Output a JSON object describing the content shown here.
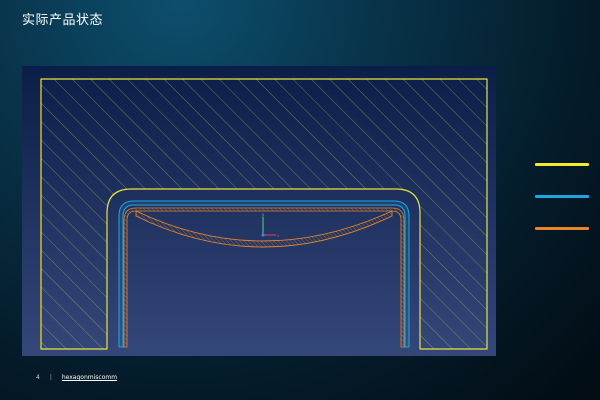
{
  "slide": {
    "title": "实际产品状态",
    "page_number": "4",
    "separator": "|",
    "brand": "hexagonmiscomm"
  },
  "colors": {
    "background_top": "#0d4f6e",
    "viewport_top": "#0b1e48",
    "viewport_bottom": "#344779",
    "outer_die": "#e8e23a",
    "blue_part": "#1fa6e0",
    "orange_part": "#e8852a"
  },
  "legend": [
    {
      "color": "#f2e933"
    },
    {
      "color": "#1fa6e0"
    },
    {
      "color": "#e8852a"
    }
  ],
  "triad": {
    "y_label": "y",
    "x_label": "x"
  }
}
